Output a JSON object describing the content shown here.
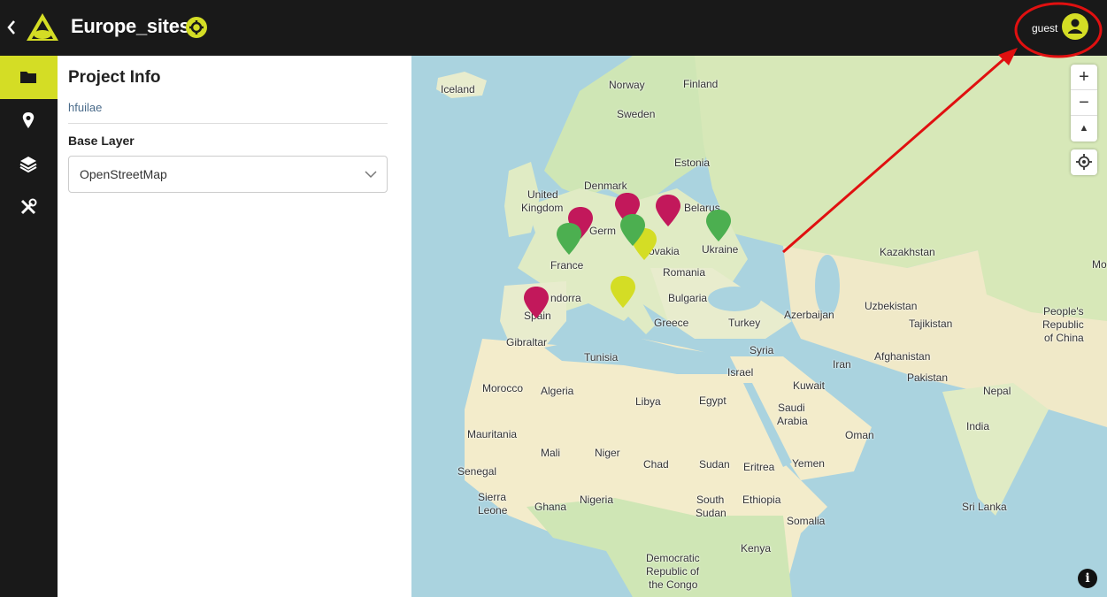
{
  "header": {
    "back_icon": "chevron-left-icon",
    "title": "Europe_sites",
    "user_name": "guest",
    "accent": "#d4dd25"
  },
  "sidebar": {
    "items": [
      {
        "icon": "folder-icon",
        "active": true
      },
      {
        "icon": "map-pin-icon",
        "active": false
      },
      {
        "icon": "layers-icon",
        "active": false
      },
      {
        "icon": "tools-icon",
        "active": false
      }
    ]
  },
  "panel": {
    "heading": "Project Info",
    "description": "hfuilae",
    "base_layer_label": "Base Layer",
    "base_layer_value": "OpenStreetMap"
  },
  "map": {
    "zoom_in": "+",
    "zoom_out": "−",
    "reset_north": "▲",
    "info": "i",
    "labels": {
      "iceland": "Iceland",
      "norway": "Norway",
      "finland": "Finland",
      "sweden": "Sweden",
      "estonia": "Estonia",
      "denmark": "Denmark",
      "united": "United",
      "kingdom": "Kingdom",
      "belarus": "Belarus",
      "germany": "Germ",
      "ukraine": "Ukraine",
      "slovakia": "ovakia",
      "france": "France",
      "romania": "Romania",
      "kazakhstan": "Kazakhstan",
      "mo": "Mo",
      "andorra": "ndorra",
      "bulgaria": "Bulgaria",
      "spain": "Spain",
      "azerbaijan": "Azerbaijan",
      "uzbekistan": "Uzbekistan",
      "peoples": "People's",
      "republic": "Republic",
      "ofchina": "of China",
      "greece": "Greece",
      "turkey": "Turkey",
      "tajikistan": "Tajikistan",
      "gibraltar": "Gibraltar",
      "syria": "Syria",
      "afghanistan": "Afghanistan",
      "tunisia": "Tunisia",
      "iran": "Iran",
      "israel": "Israel",
      "pakistan": "Pakistan",
      "morocco": "Morocco",
      "algeria": "Algeria",
      "kuwait": "Kuwait",
      "nepal": "Nepal",
      "libya": "Libya",
      "egypt": "Egypt",
      "saudi": "Saudi",
      "arabia": "Arabia",
      "india": "India",
      "mauritania": "Mauritania",
      "oman": "Oman",
      "mali": "Mali",
      "niger": "Niger",
      "chad": "Chad",
      "sudan": "Sudan",
      "eritrea": "Eritrea",
      "yemen": "Yemen",
      "senegal": "Senegal",
      "sierra": "Sierra",
      "leone": "Leone",
      "ghana": "Ghana",
      "nigeria": "Nigeria",
      "south": "South",
      "sudan2": "Sudan",
      "ethiopia": "Ethiopia",
      "srilanka": "Sri Lanka",
      "somalia": "Somalia",
      "kenya": "Kenya",
      "drc1": "Democratic",
      "drc2": "Republic of",
      "drc3": "the Congo"
    },
    "marker_colors": {
      "crimson": "#c2185b",
      "green": "#4caf50",
      "yellow": "#d4dd25"
    }
  }
}
